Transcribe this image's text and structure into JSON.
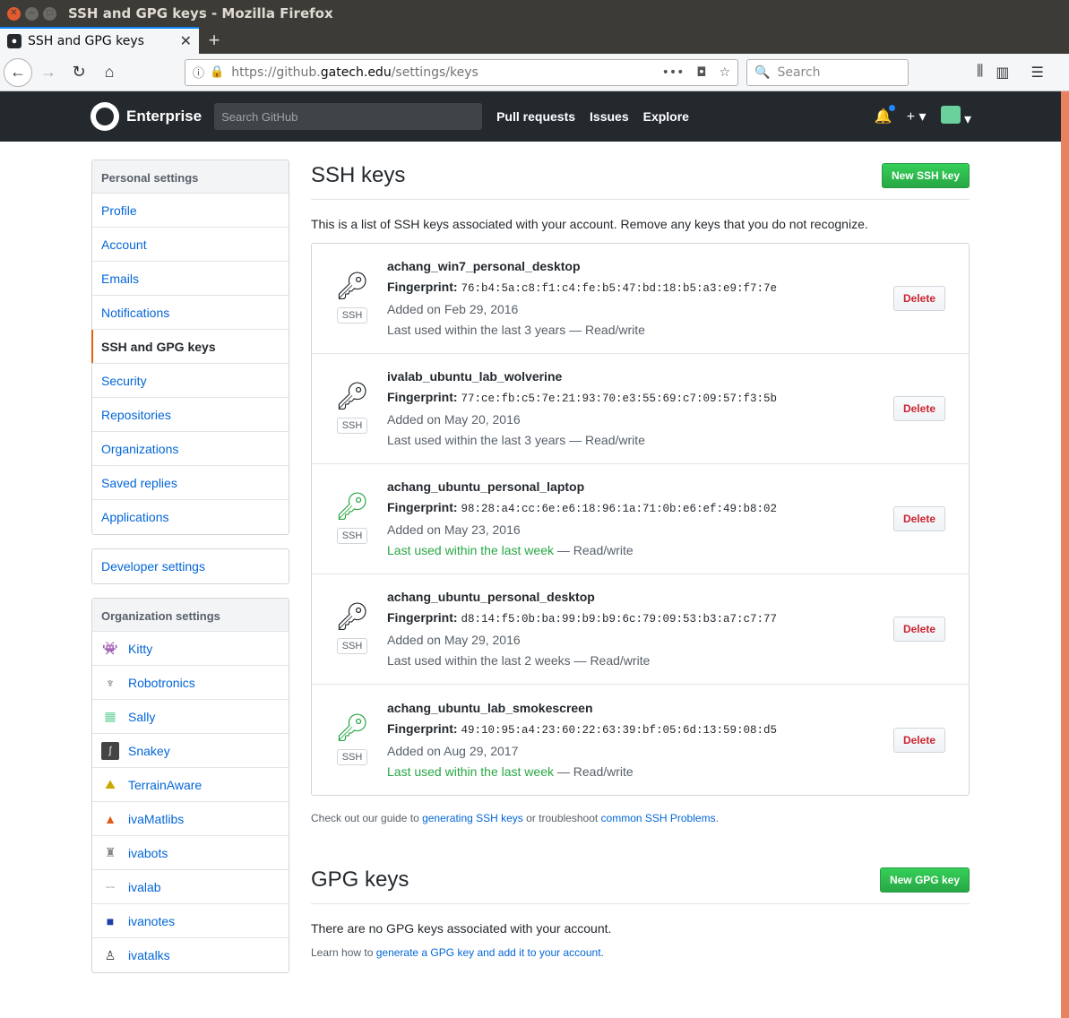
{
  "window": {
    "title": "SSH and GPG keys - Mozilla Firefox"
  },
  "browser": {
    "tab_title": "SSH and GPG keys",
    "url_prefix": "https://github.",
    "url_host": "gatech.edu",
    "url_path": "/settings/keys",
    "search_placeholder": "Search"
  },
  "header": {
    "brand": "Enterprise",
    "search_placeholder": "Search GitHub",
    "nav": [
      "Pull requests",
      "Issues",
      "Explore"
    ]
  },
  "sidebar": {
    "personal_heading": "Personal settings",
    "personal_items": [
      "Profile",
      "Account",
      "Emails",
      "Notifications",
      "SSH and GPG keys",
      "Security",
      "Repositories",
      "Organizations",
      "Saved replies",
      "Applications"
    ],
    "developer": "Developer settings",
    "org_heading": "Organization settings",
    "orgs": [
      {
        "name": "Kitty",
        "icon": "alien-icon",
        "color": "#3fbf3f"
      },
      {
        "name": "Robotronics",
        "icon": "robot-icon",
        "color": "#555555"
      },
      {
        "name": "Sally",
        "icon": "pixel-icon",
        "color": "#6ad19c"
      },
      {
        "name": "Snakey",
        "icon": "snake-icon",
        "color": "#444444"
      },
      {
        "name": "TerrainAware",
        "icon": "terrain-icon",
        "color": "#c9a800"
      },
      {
        "name": "ivaMatlibs",
        "icon": "matlab-icon",
        "color": "#e05a1a"
      },
      {
        "name": "ivabots",
        "icon": "bot-icon",
        "color": "#888888"
      },
      {
        "name": "ivalab",
        "icon": "lab-icon",
        "color": "#777777"
      },
      {
        "name": "ivanotes",
        "icon": "notebook-icon",
        "color": "#1e3fa8"
      },
      {
        "name": "ivatalks",
        "icon": "presenter-icon",
        "color": "#333333"
      }
    ]
  },
  "ssh": {
    "heading": "SSH keys",
    "new_button": "New SSH key",
    "intro": "This is a list of SSH keys associated with your account. Remove any keys that you do not recognize.",
    "fingerprint_label": "Fingerprint:",
    "badge": "SSH",
    "delete_label": "Delete",
    "keys": [
      {
        "title": "achang_win7_personal_desktop",
        "fingerprint": "76:b4:5a:c8:f1:c4:fe:b5:47:bd:18:b5:a3:e9:f7:7e",
        "added": "Added on Feb 29, 2016",
        "last_used": "Last used within the last 3 years",
        "access": " — Read/write",
        "recent": false
      },
      {
        "title": "ivalab_ubuntu_lab_wolverine",
        "fingerprint": "77:ce:fb:c5:7e:21:93:70:e3:55:69:c7:09:57:f3:5b",
        "added": "Added on May 20, 2016",
        "last_used": "Last used within the last 3 years",
        "access": " — Read/write",
        "recent": false
      },
      {
        "title": "achang_ubuntu_personal_laptop",
        "fingerprint": "98:28:a4:cc:6e:e6:18:96:1a:71:0b:e6:ef:49:b8:02",
        "added": "Added on May 23, 2016",
        "last_used": "Last used within the last week",
        "access": " — Read/write",
        "recent": true
      },
      {
        "title": "achang_ubuntu_personal_desktop",
        "fingerprint": "d8:14:f5:0b:ba:99:b9:b9:6c:79:09:53:b3:a7:c7:77",
        "added": "Added on May 29, 2016",
        "last_used": "Last used within the last 2 weeks",
        "access": " — Read/write",
        "recent": false
      },
      {
        "title": "achang_ubuntu_lab_smokescreen",
        "fingerprint": "49:10:95:a4:23:60:22:63:39:bf:05:6d:13:59:08:d5",
        "added": "Added on Aug 29, 2017",
        "last_used": "Last used within the last week",
        "access": " — Read/write",
        "recent": true
      }
    ],
    "note_prefix": "Check out our guide to ",
    "note_link1": "generating SSH keys",
    "note_mid": " or troubleshoot ",
    "note_link2": "common SSH Problems",
    "note_suffix": "."
  },
  "gpg": {
    "heading": "GPG keys",
    "new_button": "New GPG key",
    "empty": "There are no GPG keys associated with your account.",
    "note_prefix": "Learn how to ",
    "note_link": "generate a GPG key and add it to your account",
    "note_suffix": "."
  },
  "colors": {
    "accent_green": "#28a745",
    "link": "#0366d6",
    "danger": "#cb2431",
    "selected_bar": "#e36209"
  }
}
